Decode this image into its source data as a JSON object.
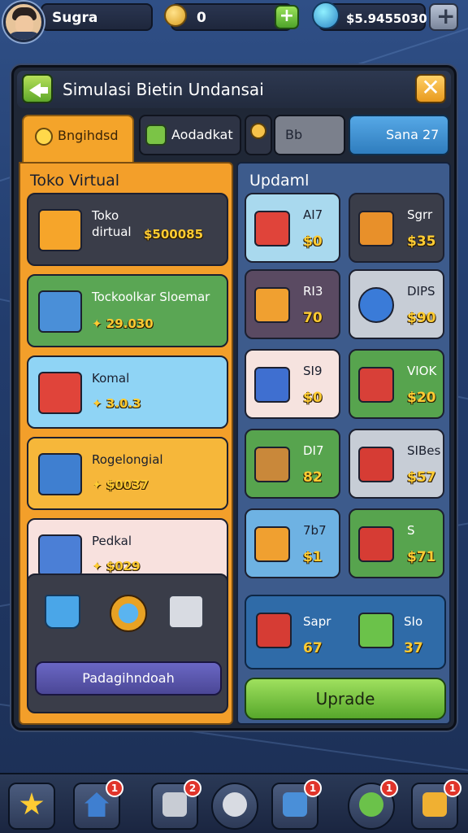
{
  "topbar": {
    "player_name": "Sugra",
    "coins": "0",
    "money": "$5.9455030"
  },
  "panel": {
    "title": "Simulasi Bietin Undansai",
    "tabs": [
      {
        "label": "Bngihdsd"
      },
      {
        "label": "Aodadkat"
      },
      {
        "label": ""
      },
      {
        "label": "Bb"
      },
      {
        "label": "Sana 27"
      }
    ]
  },
  "left_section": {
    "title": "Toko Virtual",
    "items": [
      {
        "name": "Toko dirtual",
        "price": "$500085"
      },
      {
        "name": "Tockoolkar Sloemar",
        "price": "29.030"
      },
      {
        "name": "Komal",
        "price": "3.0.3"
      },
      {
        "name": "Rogelongial",
        "price": "$0037"
      },
      {
        "name": "Pedkal",
        "price": "$029"
      }
    ],
    "button_label": "Padagihndoah"
  },
  "right_section": {
    "title": "Updaml",
    "items": [
      {
        "name": "AI7",
        "price": "$0"
      },
      {
        "name": "Sgrr",
        "price": "$35"
      },
      {
        "name": "RI3",
        "price": "70"
      },
      {
        "name": "DIPS",
        "price": "$90"
      },
      {
        "name": "SI9",
        "price": "$0"
      },
      {
        "name": "VIOK",
        "price": "$20"
      },
      {
        "name": "DI7",
        "price": "82"
      },
      {
        "name": "SIBes",
        "price": "$57"
      },
      {
        "name": "7b7",
        "price": "$1"
      },
      {
        "name": "S",
        "price": "$71"
      }
    ],
    "combo": [
      {
        "name": "Sapr",
        "price": "67"
      },
      {
        "name": "SIo",
        "price": "37"
      }
    ],
    "upgrade_label": "Uprade"
  },
  "bottom_nav": {
    "badges": [
      "",
      "1",
      "2",
      "",
      "1",
      "1",
      "1"
    ]
  },
  "colors": {
    "accent_orange": "#f39f2a",
    "accent_green": "#5fa82a",
    "accent_blue": "#2f7dbe",
    "price_gold": "#ffcc33",
    "badge_red": "#e0342a"
  }
}
